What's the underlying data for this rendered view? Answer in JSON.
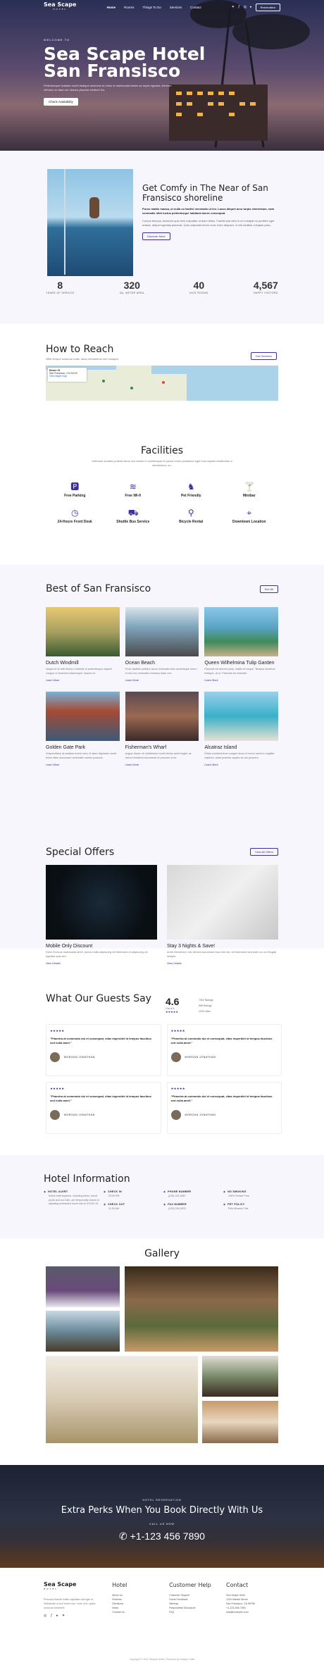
{
  "nav": {
    "logo": "Sea Scape",
    "logo_sub": "HOTEL",
    "links": [
      "Home",
      "Rooms",
      "Things To Do",
      "Services",
      "Contact"
    ],
    "reserve": "Reservation"
  },
  "hero": {
    "welcome": "WELCOME TO",
    "title_1": "Sea Scape Hotel",
    "title_2": "San Fransisco",
    "paragraph": "Pellentesque habitant morbi tristique senectus et netus et malesuada fames ac turpis egestas. Aenean ultricies mi vitae est. Mauris placerat eleifend leo.",
    "button": "Check Availability"
  },
  "about": {
    "title": "Get Comfy in The Near of San Fransisco shoreline",
    "bold_text": "Purus mattis massa, ut nulla eu facilisi venenatis ut leo. Lacus aliquet arcu turpis elementum, nam venenatis nibh luctus pellentesque habitant donec consequat.",
    "text": "Cursus tempus, tincidunt quis sem vulputate ut diam tellus. Facilisi sed nibh in mi volutpat mi porttitor eget massa, aliquet egestas placerat. Quis vulputate lorem nunc enim aliquam, in nisi facilisis volutpat porta.",
    "button": "Discover More",
    "stats": [
      {
        "value": "8",
        "label": "YEARS OF SERVICE"
      },
      {
        "value": "320",
        "label": "SQ. METER AREA"
      },
      {
        "value": "40",
        "label": "NICE ROOMS"
      },
      {
        "value": "4,567",
        "label": "HAPPY VISITORS"
      }
    ]
  },
  "reach": {
    "title": "How to Reach",
    "desc": "Nibh tempor euismod nulla, lacus elementum sed volutpat.",
    "button": "Get Direction",
    "map_box": "Beach St",
    "map_box_2": "San Francisco, CA 94133",
    "map_box_3": "View larger map"
  },
  "facilities": {
    "title": "Facilities",
    "desc": "Interdum sodales potenti lacus orci auctor in scelerisque et ipsum lorem phasellus eget eros sapien vestibulum a elementum, eu.",
    "items": [
      {
        "icon": "parking-icon",
        "label": "Free Parking"
      },
      {
        "icon": "wifi-icon",
        "label": "Free Wi-fi"
      },
      {
        "icon": "pet-icon",
        "label": "Pet Friendly"
      },
      {
        "icon": "minibar-icon",
        "label": "Minibar"
      },
      {
        "icon": "clock-icon",
        "label": "24-Hours Front Desk"
      },
      {
        "icon": "bus-icon",
        "label": "Shuttle Bus Service"
      },
      {
        "icon": "bicycle-icon",
        "label": "Bicycle Rental"
      },
      {
        "icon": "location-icon",
        "label": "Downtown Location"
      }
    ]
  },
  "best": {
    "title": "Best of San Fransisco",
    "button": "See All",
    "link": "Learn More",
    "cards": [
      {
        "title": "Dutch Windmill",
        "text": "Neque et id velit dictum molestie et pellentesque aliquet congue et tincidunt ullamcorper mauris mi."
      },
      {
        "title": "Ocean Beach",
        "text": "Proin facilisis porttitor lacus venenatis felis scelerisque lorem et nisl orci venenatis vivamus diam nec."
      },
      {
        "title": "Queen Wilhelmina Tulip Garden",
        "text": "Placerat vel laoreet justo, mattis et neque. Tempus faucibus tristique, at ut. Placerat vel molestie."
      },
      {
        "title": "Golden Gate Park",
        "text": "Suspendisse at sodales morbi urna, id diam dignissim amet tellus diam accumsan venenatis nullam posuere."
      },
      {
        "title": "Fisherman's Wharf",
        "text": "Augue donec mi vestibulum morbi lectus amet fugiat, ac rutrum tincidunt accumsan et posuere urna."
      },
      {
        "title": "Alcatraz Island",
        "text": "Etiam condimentum congue lacus id lorem morbi in sagittis dapibus, amet pulvinar sapien ac dui posuere."
      }
    ]
  },
  "offers": {
    "title": "Special Offers",
    "button": "View All Offers",
    "link": "View Details",
    "cards": [
      {
        "title": "Mobile Only Discount",
        "text": "Dolor rhoncus malesuada amet, purus mollis adipiscing vel bibendum et adipiscing vel egestas quis sed."
      },
      {
        "title": "Stay 3 Nights & Save!",
        "text": "Amet elementum nisi ultrices accumsan risus sed est, vel bibendum sed diam ac orci feugiat semper."
      }
    ]
  },
  "guests": {
    "title": "What Our Guests Say",
    "score": "4.6",
    "out_of": "Out of 5",
    "bars": [
      "7062 Ratings",
      "968 Ratings",
      "1204 Likes"
    ],
    "reviews": [
      {
        "stars": "★★★★★",
        "quote": "\"Pharetra at commodo dui et consequat, vitae imperdiet id tempus faucibus sed nulla amet.\"",
        "name": "MORGAN JONATHAN"
      },
      {
        "stars": "★★★★★",
        "quote": "\"Pharetra at commodo dui et consequat, vitae imperdiet id tempus faucibus sed nulla amet.\"",
        "name": "MORGAN JONATHAN"
      },
      {
        "stars": "★★★★★",
        "quote": "\"Pharetra at commodo dui et consequat, vitae imperdiet id tempus faucibus sed nulla amet.\"",
        "name": "MORGAN JONATHAN"
      },
      {
        "stars": "★★★★★",
        "quote": "\"Pharetra at commodo dui et consequat, vitae imperdiet id tempus faucibus sed nulla amet.\"",
        "name": "MORGAN JONATHAN"
      }
    ]
  },
  "info": {
    "title": "Hotel Information",
    "items": [
      {
        "title": "HOTEL ALERT",
        "value": "Some hotel features, including hikes, resort pools and our Cafe, are temporarily closed or adjusting scheduled hours due to COVID-19."
      },
      {
        "title": "CHECK IN",
        "value": "03:00 PM"
      },
      {
        "title": "PHONE NUMBER",
        "value": "(415) 123-4567"
      },
      {
        "title": "NO SMOKING",
        "value": "100% Smoke Free"
      },
      {
        "title": "CHECK OUT",
        "value": "11:00 AM"
      },
      {
        "title": "FAX NUMBER",
        "value": "(415) 234-5678"
      },
      {
        "title": "PET POLICY",
        "value": "Pets Allowed: Yes"
      }
    ]
  },
  "gallery": {
    "title": "Gallery"
  },
  "cta": {
    "kicker": "HOTEL RESERVATION",
    "title": "Extra Perks When You Book Directly With Us",
    "kicker_2": "CALL US NOW",
    "phone": "+1-123 456 7890"
  },
  "footer": {
    "logo": "Sea Scape",
    "logo_sub": "HOTEL",
    "desc": "Rhoncus blandit mollis vulputate nisl eget id. Sollicitudin ut orci lorem non, nunc ut in, quam luctus ac hendrerit.",
    "cols": [
      {
        "title": "Hotel",
        "items": [
          "About Us",
          "Reviews",
          "Directions",
          "News",
          "Contact Us"
        ]
      },
      {
        "title": "Customer Help",
        "items": [
          "Customer Support",
          "Guest Feedback",
          "Sitemap",
          "Responsible Disclosure",
          "FAQ"
        ]
      },
      {
        "title": "Contact",
        "items": [
          "Sea Scape Hotel",
          "1234 Market Street",
          "San Francisco, CA 98765",
          "+1-123-456-7890",
          "mail@example.com"
        ]
      }
    ],
    "copyright": "Copyright © 2021 Seaspe Hotel | Powered by Seaspe Hotel"
  }
}
